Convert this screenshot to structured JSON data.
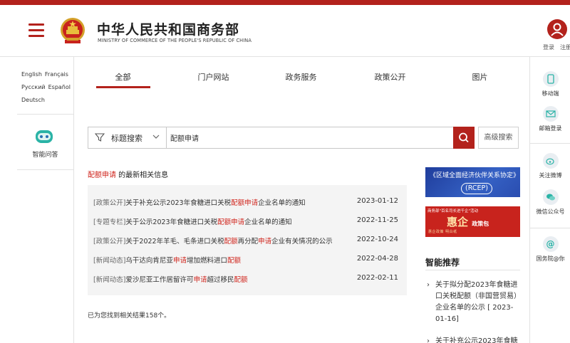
{
  "header": {
    "title": "中华人民共和国商务部",
    "subtitle": "MINISTRY OF COMMERCE OF THE PEOPLE'S REPUBLIC OF CHINA",
    "login": "登录",
    "register": "注册"
  },
  "left": {
    "languages": [
      "English",
      "Français",
      "Русский",
      "Español",
      "Deutsch"
    ],
    "assistant_label": "智能问答"
  },
  "right": {
    "items": [
      "移动端",
      "邮箱登录",
      "关注微博",
      "微信公众号",
      "国务院@你"
    ]
  },
  "tabs": [
    "全部",
    "门户网站",
    "政务服务",
    "政策公开",
    "图片"
  ],
  "search": {
    "filter_label": "标题搜索",
    "query": "配额申请",
    "advanced_label": "高级搜索"
  },
  "results_heading": {
    "keyword": "配额申请",
    "suffix": " 的最新相关信息"
  },
  "results": [
    {
      "category": "[政策公开]",
      "parts": [
        [
          "关于补充公示2023年食糖进口关税",
          false
        ],
        [
          "配额申请",
          true
        ],
        [
          "企业名单的通知",
          false
        ]
      ],
      "date": "2023-01-12"
    },
    {
      "category": "[专题专栏]",
      "parts": [
        [
          "关于公示2023年食糖进口关税",
          false
        ],
        [
          "配额申请",
          true
        ],
        [
          "企业名单的通知",
          false
        ]
      ],
      "date": "2022-11-25"
    },
    {
      "category": "[政策公开]",
      "parts": [
        [
          "关于2022年羊毛、毛条进口关税",
          false
        ],
        [
          "配额",
          true
        ],
        [
          "再分配",
          false
        ],
        [
          "申请",
          true
        ],
        [
          "企业有关情况的公示",
          false
        ]
      ],
      "date": "2022-10-24"
    },
    {
      "category": "[新闻动态]",
      "parts": [
        [
          "乌干达向肯尼亚",
          false
        ],
        [
          "申请",
          true
        ],
        [
          "增加燃料进口",
          false
        ],
        [
          "配额",
          true
        ]
      ],
      "date": "2022-04-28"
    },
    {
      "category": "[新闻动态]",
      "parts": [
        [
          "爱沙尼亚工作居留许可",
          false
        ],
        [
          "申请",
          true
        ],
        [
          "超过移民",
          false
        ],
        [
          "配额",
          true
        ]
      ],
      "date": "2022-02-11"
    }
  ],
  "result_count": "已为您找到相关结果158个。",
  "banners": {
    "rcep_title": "《区域全面经济伙伴关系协定》",
    "rcep_tag": "(RCEP)",
    "huiqi_top": "商务部\"百名司长进千企\"活动",
    "huiqi_main": "惠企",
    "huiqi_sub": "政策包",
    "huiqi_bottom": "惠企政策 明白纸"
  },
  "smart": {
    "title": "智能推荐",
    "items": [
      "关于拟分配2023年食糖进口关税配额（非国营贸易）企业名单的公示 [ 2023-01-16]",
      "关于补充公示2023年食糖"
    ]
  },
  "colors": {
    "brand_red": "#b3221c",
    "highlight_red": "#d0261e"
  }
}
